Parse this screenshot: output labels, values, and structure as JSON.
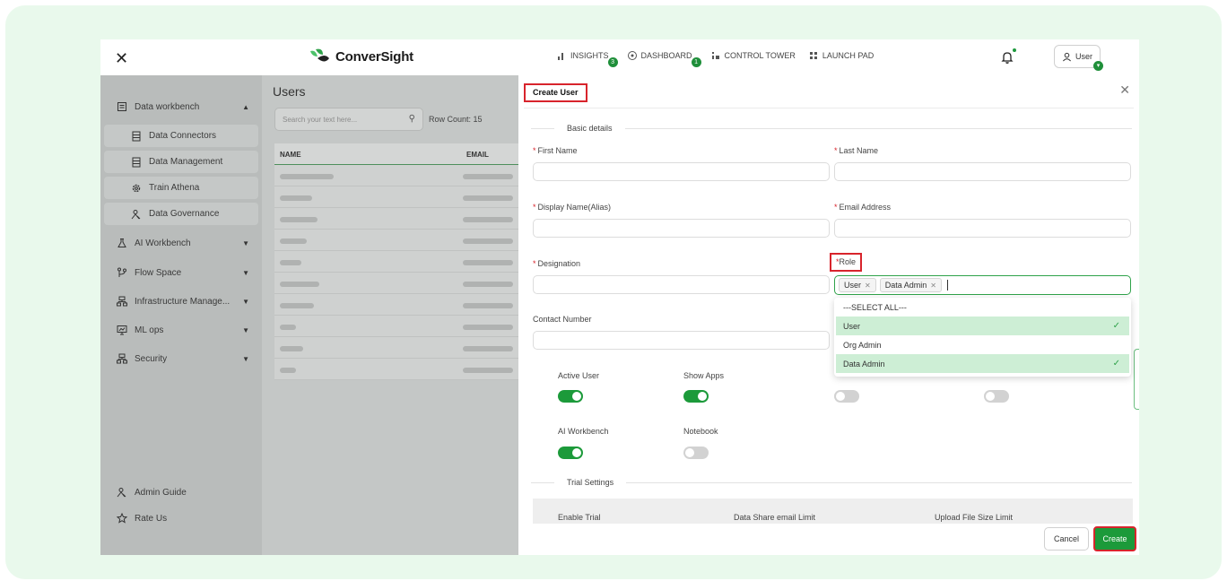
{
  "app": {
    "logo_text": "ConverSight",
    "nav": [
      {
        "label": "INSIGHTS",
        "badge": "3"
      },
      {
        "label": "DASHBOARD",
        "badge": "1"
      },
      {
        "label": "CONTROL TOWER",
        "badge": ""
      },
      {
        "label": "LAUNCH PAD",
        "badge": ""
      }
    ],
    "user_label": "User"
  },
  "sidebar": {
    "items": [
      {
        "label": "Data workbench",
        "icon": "workbench-icon",
        "expanded": true
      },
      {
        "label": "AI Workbench",
        "icon": "flask-icon"
      },
      {
        "label": "Flow Space",
        "icon": "flow-icon"
      },
      {
        "label": "Infrastructure Manage...",
        "icon": "infrastructure-icon"
      },
      {
        "label": "ML ops",
        "icon": "monitor-icon"
      },
      {
        "label": "Security",
        "icon": "security-icon"
      }
    ],
    "subitems": [
      {
        "label": "Data Connectors",
        "icon": "document-icon"
      },
      {
        "label": "Data Management",
        "icon": "document-icon"
      },
      {
        "label": "Train Athena",
        "icon": "gear-icon"
      },
      {
        "label": "Data Governance",
        "icon": "people-icon"
      }
    ],
    "footer": [
      {
        "label": "Admin Guide",
        "icon": "people-icon"
      },
      {
        "label": "Rate Us",
        "icon": "star-icon"
      }
    ]
  },
  "users": {
    "title": "Users",
    "search_placeholder": "Search your text here...",
    "row_count": "Row Count: 15",
    "columns": [
      "NAME",
      "EMAIL"
    ]
  },
  "modal": {
    "title": "Create User",
    "section_basic": "Basic details",
    "first_name_label": "First Name",
    "last_name_label": "Last Name",
    "display_name_label": "Display Name(Alias)",
    "email_label": "Email Address",
    "designation_label": "Designation",
    "role_label": "Role",
    "contact_label": "Contact Number",
    "selected_roles": [
      "User",
      "Data Admin"
    ],
    "role_options": [
      {
        "label": "---SELECT ALL---",
        "selected": false
      },
      {
        "label": "User",
        "selected": true
      },
      {
        "label": "Org Admin",
        "selected": false
      },
      {
        "label": "Data Admin",
        "selected": true
      }
    ],
    "toggles": [
      {
        "label": "Active User",
        "on": true
      },
      {
        "label": "Show Apps",
        "on": true
      },
      {
        "label": "",
        "on": false
      },
      {
        "label": "",
        "on": false
      },
      {
        "label": "AI Workbench",
        "on": true
      },
      {
        "label": "Notebook",
        "on": false
      }
    ],
    "section_trial": "Trial Settings",
    "trial_cols": [
      "Enable Trial",
      "Data Share email Limit",
      "Upload File Size Limit"
    ],
    "cancel_label": "Cancel",
    "create_label": "Create"
  },
  "colors": {
    "brand_green": "#1c9a3a",
    "highlight_red": "#d8242c",
    "outer_bg": "#e9f9ec"
  }
}
